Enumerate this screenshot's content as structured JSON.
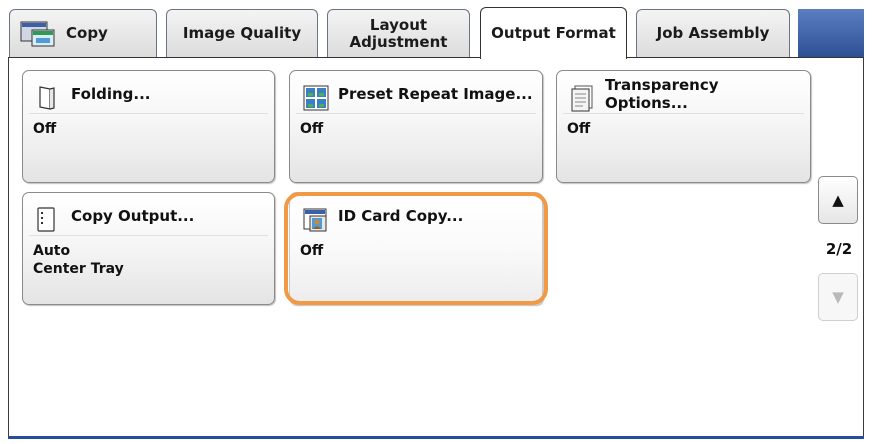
{
  "tabs": [
    {
      "label": "Copy",
      "active": false
    },
    {
      "label": "Image Quality",
      "active": false
    },
    {
      "label": "Layout\nAdjustment",
      "active": false
    },
    {
      "label": "Output Format",
      "active": true
    },
    {
      "label": "Job Assembly",
      "active": false
    }
  ],
  "features": {
    "folding": {
      "title": "Folding...",
      "value": "Off",
      "icon": "folding-page-icon"
    },
    "preset_repeat": {
      "title": "Preset Repeat Image...",
      "value": "Off",
      "icon": "preset-repeat-image-icon"
    },
    "transparency": {
      "title": "Transparency\nOptions...",
      "value": "Off",
      "icon": "transparency-sheet-icon"
    },
    "copy_output": {
      "title": "Copy Output...",
      "value_line1": "Auto",
      "value_line2": "Center Tray",
      "icon": "copy-output-icon"
    },
    "id_card": {
      "title": "ID Card Copy...",
      "value": "Off",
      "icon": "id-card-icon",
      "highlighted": true
    }
  },
  "pagination": {
    "indicator": "2/2",
    "up_symbol": "▲",
    "down_symbol": "▼",
    "down_enabled": false
  },
  "colors": {
    "highlight": "#f19a45",
    "tab_bar_accent": "#2e4f94"
  }
}
